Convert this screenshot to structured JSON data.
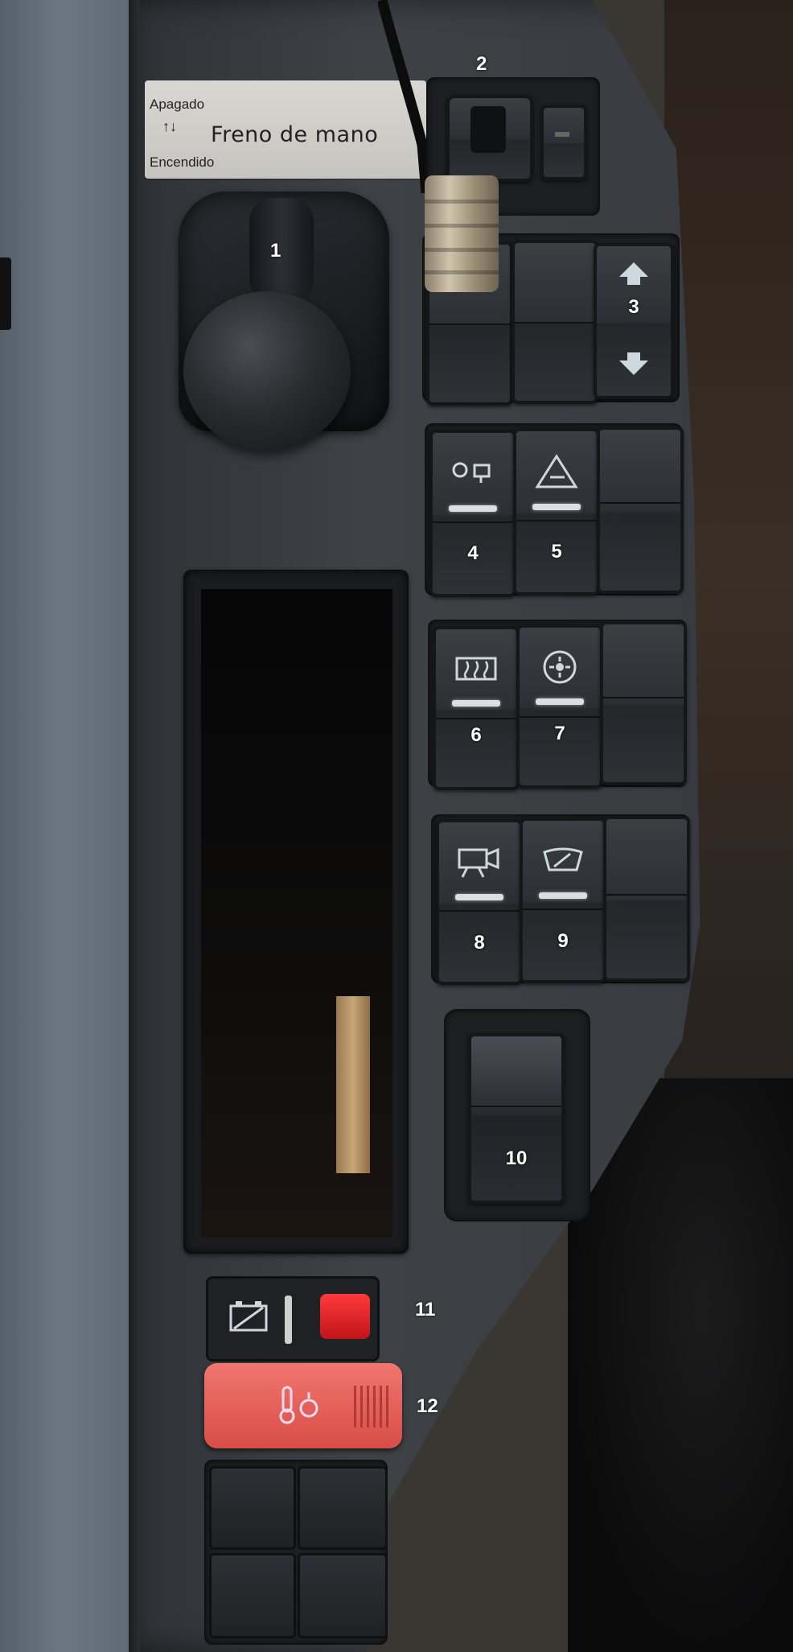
{
  "sticker": {
    "off_label": "Apagado",
    "arrows": "↑↓",
    "on_label": "Encendido",
    "title": "Freno de mano"
  },
  "callouts": {
    "c1": "1",
    "c2": "2",
    "c3": "3",
    "c4": "4",
    "c5": "5",
    "c6": "6",
    "c7": "7",
    "c8": "8",
    "c9": "9",
    "c10": "10",
    "c11": "11",
    "c12": "12"
  },
  "icons": {
    "sw4": "fan-out-icon",
    "sw5": "warning-triangle-icon",
    "sw6": "rear-defrost-icon",
    "sw7": "fan-circulation-icon",
    "sw8": "camera-icon",
    "sw9": "windshield-wiper-icon",
    "sw11": "battery-icon",
    "sw12": "temperature-heater-icon"
  },
  "colors": {
    "indicator": "#d9dfe3",
    "red_switch": "#d94d47",
    "battery_switch": "#e0202a"
  }
}
